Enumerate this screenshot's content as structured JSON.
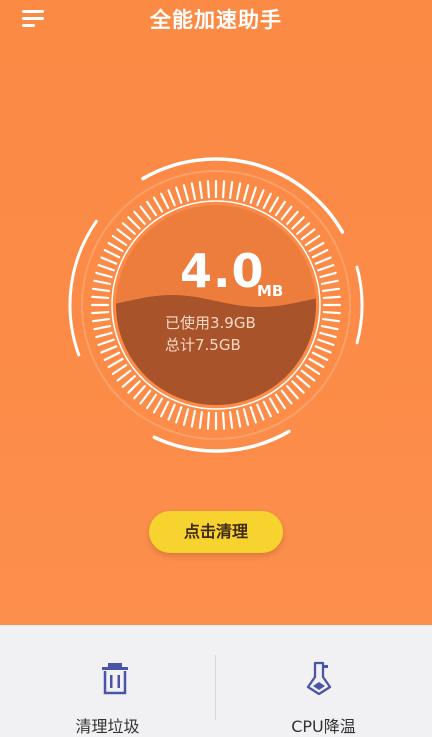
{
  "header": {
    "title": "全能加速助手",
    "menu_icon": "menu-icon"
  },
  "gauge": {
    "value": "4.0",
    "unit": "MB",
    "used_label": "已使用3.9GB",
    "total_label": "总计7.5GB",
    "used_fraction": 0.52,
    "colors": {
      "liquid": "#a9532b",
      "ring": "#ffffff",
      "inner_bg": "#ec7d3d"
    }
  },
  "actions": {
    "clean_button": "点击清理"
  },
  "bottom_nav": [
    {
      "label": "清理垃圾",
      "icon": "trash-icon"
    },
    {
      "label": "CPU降温",
      "icon": "thermometer-icon"
    }
  ],
  "colors": {
    "primary": "#fb8a45",
    "button": "#f7d330",
    "bottom_bg": "#f1f0f2"
  }
}
